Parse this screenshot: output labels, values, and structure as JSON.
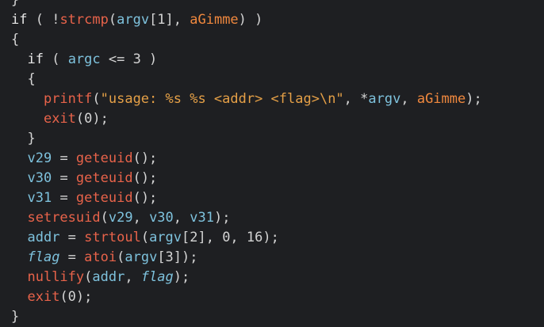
{
  "colors": {
    "background": "#1e1f22",
    "text": "#d4d4d4",
    "function": "#e8634a",
    "variable": "#7ec2dd",
    "global": "#f0883e",
    "string": "#e5a047"
  },
  "code": {
    "lines": [
      {
        "indent": 0,
        "tokens": [
          {
            "t": "}",
            "c": "pn"
          }
        ]
      },
      {
        "indent": 0,
        "tokens": [
          {
            "t": "if",
            "c": "kw"
          },
          {
            "t": " ( !",
            "c": "pn"
          },
          {
            "t": "strcmp",
            "c": "fn"
          },
          {
            "t": "(",
            "c": "pn"
          },
          {
            "t": "argv",
            "c": "var"
          },
          {
            "t": "[1], ",
            "c": "pn"
          },
          {
            "t": "aGimme",
            "c": "glob"
          },
          {
            "t": ") )",
            "c": "pn"
          }
        ]
      },
      {
        "indent": 0,
        "tokens": [
          {
            "t": "{",
            "c": "pn"
          }
        ]
      },
      {
        "indent": 1,
        "tokens": [
          {
            "t": "if",
            "c": "kw"
          },
          {
            "t": " ( ",
            "c": "pn"
          },
          {
            "t": "argc",
            "c": "var"
          },
          {
            "t": " <= 3 )",
            "c": "pn"
          }
        ]
      },
      {
        "indent": 1,
        "tokens": [
          {
            "t": "{",
            "c": "pn"
          }
        ]
      },
      {
        "indent": 2,
        "tokens": [
          {
            "t": "printf",
            "c": "fn"
          },
          {
            "t": "(",
            "c": "pn"
          },
          {
            "t": "\"usage: %s %s <addr> <flag>\\n\"",
            "c": "str"
          },
          {
            "t": ", *",
            "c": "pn"
          },
          {
            "t": "argv",
            "c": "var"
          },
          {
            "t": ", ",
            "c": "pn"
          },
          {
            "t": "aGimme",
            "c": "glob"
          },
          {
            "t": ");",
            "c": "pn"
          }
        ]
      },
      {
        "indent": 2,
        "tokens": [
          {
            "t": "exit",
            "c": "fn"
          },
          {
            "t": "(0);",
            "c": "pn"
          }
        ]
      },
      {
        "indent": 1,
        "tokens": [
          {
            "t": "}",
            "c": "pn"
          }
        ]
      },
      {
        "indent": 1,
        "tokens": [
          {
            "t": "v29",
            "c": "var"
          },
          {
            "t": " = ",
            "c": "pn"
          },
          {
            "t": "geteuid",
            "c": "fn"
          },
          {
            "t": "();",
            "c": "pn"
          }
        ]
      },
      {
        "indent": 1,
        "tokens": [
          {
            "t": "v30",
            "c": "var"
          },
          {
            "t": " = ",
            "c": "pn"
          },
          {
            "t": "geteuid",
            "c": "fn"
          },
          {
            "t": "();",
            "c": "pn"
          }
        ]
      },
      {
        "indent": 1,
        "tokens": [
          {
            "t": "v31",
            "c": "var"
          },
          {
            "t": " = ",
            "c": "pn"
          },
          {
            "t": "geteuid",
            "c": "fn"
          },
          {
            "t": "();",
            "c": "pn"
          }
        ]
      },
      {
        "indent": 1,
        "tokens": [
          {
            "t": "setresuid",
            "c": "fn"
          },
          {
            "t": "(",
            "c": "pn"
          },
          {
            "t": "v29",
            "c": "var"
          },
          {
            "t": ", ",
            "c": "pn"
          },
          {
            "t": "v30",
            "c": "var"
          },
          {
            "t": ", ",
            "c": "pn"
          },
          {
            "t": "v31",
            "c": "var"
          },
          {
            "t": ");",
            "c": "pn"
          }
        ]
      },
      {
        "indent": 1,
        "tokens": [
          {
            "t": "addr",
            "c": "var"
          },
          {
            "t": " = ",
            "c": "pn"
          },
          {
            "t": "strtoul",
            "c": "fn"
          },
          {
            "t": "(",
            "c": "pn"
          },
          {
            "t": "argv",
            "c": "var"
          },
          {
            "t": "[2], 0, 16);",
            "c": "pn"
          }
        ]
      },
      {
        "indent": 1,
        "tokens": [
          {
            "t": "flag",
            "c": "var it"
          },
          {
            "t": " = ",
            "c": "pn"
          },
          {
            "t": "atoi",
            "c": "fn"
          },
          {
            "t": "(",
            "c": "pn"
          },
          {
            "t": "argv",
            "c": "var"
          },
          {
            "t": "[3]);",
            "c": "pn"
          }
        ]
      },
      {
        "indent": 1,
        "tokens": [
          {
            "t": "nullify",
            "c": "fn"
          },
          {
            "t": "(",
            "c": "pn"
          },
          {
            "t": "addr",
            "c": "var"
          },
          {
            "t": ", ",
            "c": "pn"
          },
          {
            "t": "flag",
            "c": "var it"
          },
          {
            "t": ");",
            "c": "pn"
          }
        ]
      },
      {
        "indent": 1,
        "tokens": [
          {
            "t": "exit",
            "c": "fn"
          },
          {
            "t": "(0);",
            "c": "pn"
          }
        ]
      },
      {
        "indent": 0,
        "tokens": [
          {
            "t": "}",
            "c": "pn"
          }
        ]
      }
    ]
  }
}
